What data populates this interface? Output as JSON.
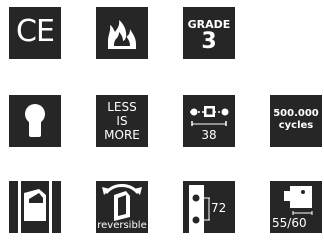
{
  "colors": {
    "tile_bg": "#262626",
    "icon_fg": "#ffffff",
    "page_bg": "#ffffff"
  },
  "tiles": {
    "ce_mark": {
      "icon": "ce-mark-icon",
      "text": "CE"
    },
    "fire_resistance": {
      "icon": "flame-icon"
    },
    "grade": {
      "label": "GRADE",
      "value": "3"
    },
    "euro_profile_cylinder": {
      "icon": "keyhole-cylinder-icon"
    },
    "less_is_more": {
      "line1": "LESS",
      "line2": "IS",
      "line3": "MORE"
    },
    "backset": {
      "icon": "backset-icon",
      "value": "38"
    },
    "cycles": {
      "line1": "500.000",
      "line2": "cycles"
    },
    "door_latch": {
      "icon": "door-latch-icon"
    },
    "reversible": {
      "icon": "reversible-rotate-icon",
      "label": "reversible"
    },
    "center_distance": {
      "icon": "strike-plate-icon",
      "value": "72"
    },
    "lock_dimensions": {
      "icon": "lock-body-icon",
      "value": "55/60"
    }
  }
}
